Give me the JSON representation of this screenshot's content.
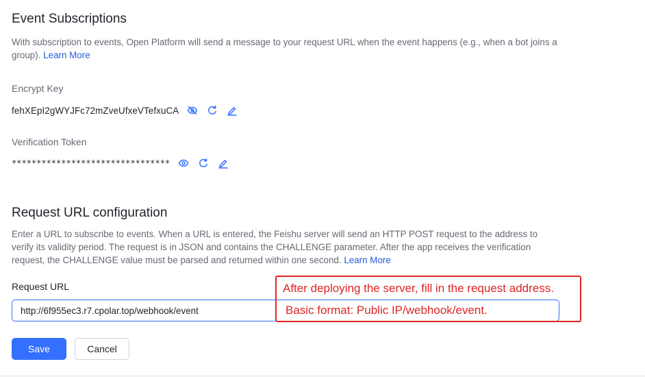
{
  "event_subscriptions": {
    "title": "Event Subscriptions",
    "description": "With subscription to events, Open Platform will send a message to your request URL when the event happens (e.g., when a bot joins a group).",
    "learn_more": "Learn More"
  },
  "encrypt_key": {
    "label": "Encrypt Key",
    "value": "fehXEpI2gWYJFc72mZveUfxeVTefxuCA",
    "icons": [
      "eye-off-icon",
      "refresh-icon",
      "edit-icon"
    ]
  },
  "verification_token": {
    "label": "Verification Token",
    "value": "********************************",
    "icons": [
      "eye-icon",
      "refresh-icon",
      "edit-icon"
    ]
  },
  "request_url_config": {
    "title": "Request URL configuration",
    "description": "Enter a URL to subscribe to events. When a URL is entered, the Feishu server will send an HTTP POST request to the address to verify its validity period. The request is in JSON and contains the CHALLENGE parameter. After the app receives the verification request, the CHALLENGE value must be parsed and returned within one second.",
    "learn_more": "Learn More",
    "field_label": "Request URL",
    "field_value": "http://6f955ec3.r7.cpolar.top/webhook/event"
  },
  "buttons": {
    "save": "Save",
    "cancel": "Cancel"
  },
  "annotation": {
    "line1": "After deploying the server, fill in the request address.",
    "line2": "Basic format: Public IP/webhook/event."
  },
  "colors": {
    "accent": "#3370ff",
    "link": "#245bdb",
    "annotation": "#e02424"
  }
}
